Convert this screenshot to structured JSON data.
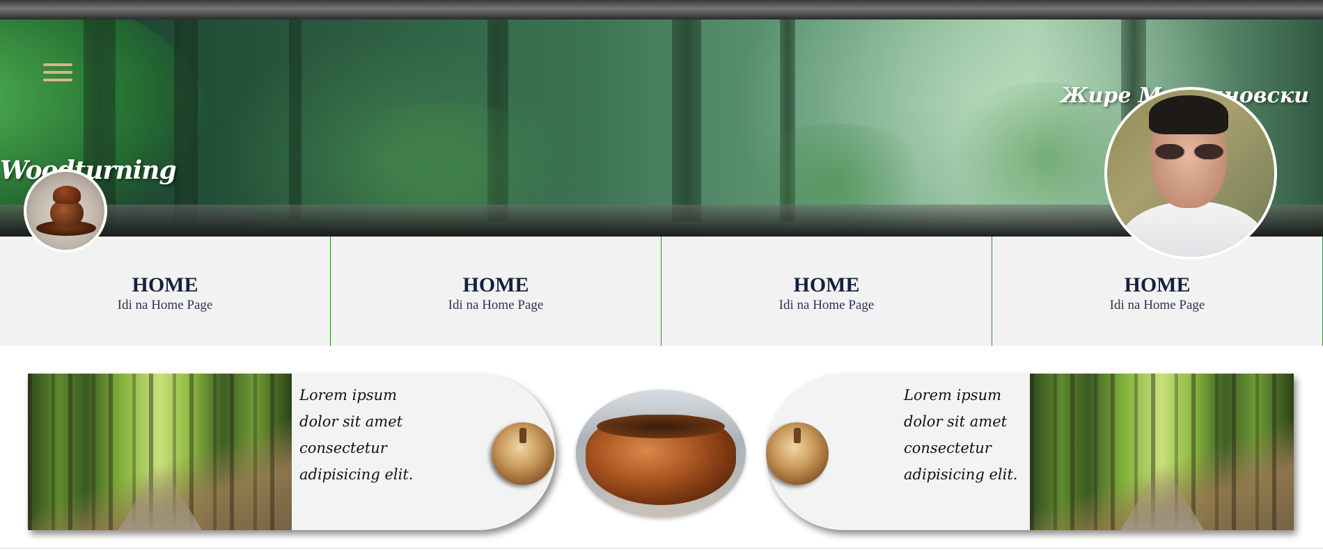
{
  "header": {
    "brand_title": "Woodturning",
    "author_name": "Жире Мерљановски",
    "menu_icon": "hamburger-menu-icon"
  },
  "nav": {
    "items": [
      {
        "title": "HOME",
        "subtitle": "Idi na Home Page"
      },
      {
        "title": "HOME",
        "subtitle": "Idi na Home Page"
      },
      {
        "title": "HOME",
        "subtitle": "Idi na Home Page"
      },
      {
        "title": "HOME",
        "subtitle": "Idi na Home Page"
      }
    ]
  },
  "cards": [
    {
      "text": "Lorem ipsum dolor sit amet consectetur adipisicing elit."
    },
    {
      "text": "Lorem ipsum dolor sit amet consectetur adipisicing elit."
    }
  ],
  "colors": {
    "accent_menu": "#d9b58a",
    "nav_divider": "#2e8b2e",
    "nav_text": "#14213d"
  }
}
